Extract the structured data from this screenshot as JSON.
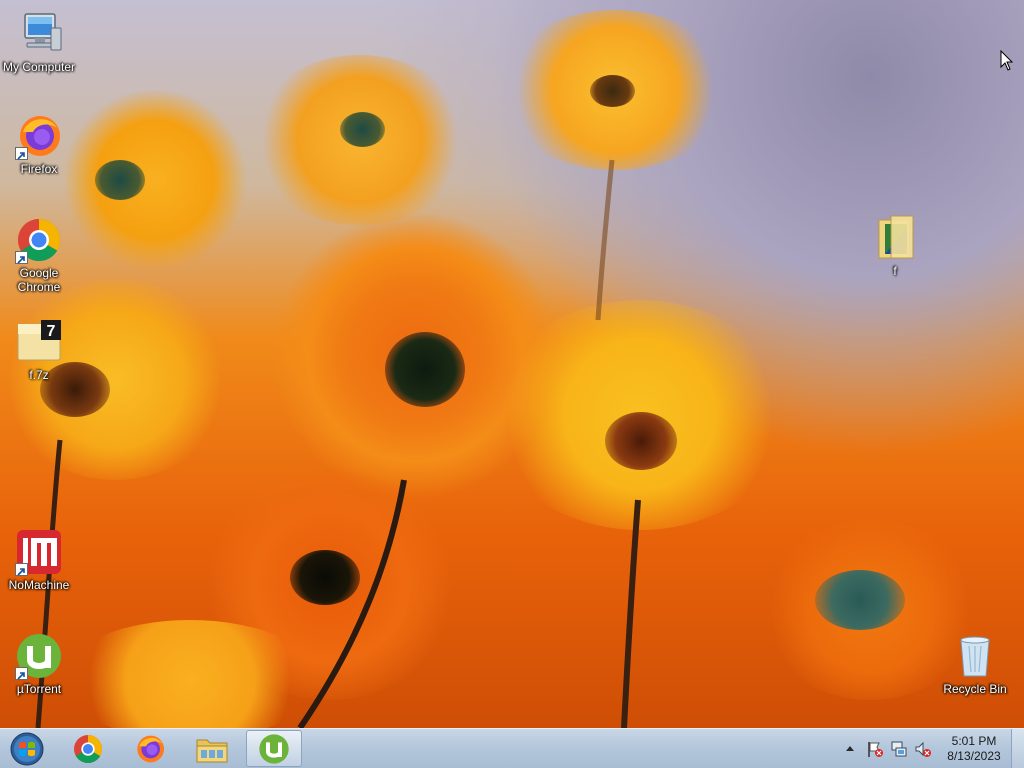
{
  "desktop_icons": [
    {
      "id": "my-computer",
      "label": "My Computer",
      "icon": "computer-icon",
      "shortcut": false
    },
    {
      "id": "firefox",
      "label": "Firefox",
      "icon": "firefox-icon",
      "shortcut": true
    },
    {
      "id": "google-chrome",
      "label": "Google Chrome",
      "icon": "chrome-icon",
      "shortcut": true
    },
    {
      "id": "f7z",
      "label": "f.7z",
      "icon": "7z-archive-icon",
      "shortcut": false
    },
    {
      "id": "nomachine",
      "label": "NoMachine",
      "icon": "nomachine-icon",
      "shortcut": true
    },
    {
      "id": "utorrent",
      "label": "µTorrent",
      "icon": "utorrent-icon",
      "shortcut": true
    },
    {
      "id": "folder-f",
      "label": "f",
      "icon": "folder-icon",
      "shortcut": false
    },
    {
      "id": "recycle-bin",
      "label": "Recycle Bin",
      "icon": "recycle-bin-icon",
      "shortcut": false
    }
  ],
  "taskbar": {
    "start_icon": "windows-start-orb-icon",
    "pinned": [
      {
        "name": "chrome",
        "icon": "chrome-icon"
      },
      {
        "name": "firefox",
        "icon": "firefox-icon"
      },
      {
        "name": "explorer",
        "icon": "folder-icon"
      },
      {
        "name": "utorrent",
        "icon": "utorrent-icon",
        "active": true
      }
    ],
    "tray_icons": [
      "show-hidden-icons-arrow",
      "action-center-flag-icon",
      "network-icon",
      "volume-muted-icon"
    ],
    "clock": {
      "time": "5:01 PM",
      "date": "8/13/2023"
    }
  },
  "colors": {
    "taskbar": "#b4c7dc",
    "desktop_label": "#ffffff",
    "wallpaper_orange": "#f08a1a"
  }
}
